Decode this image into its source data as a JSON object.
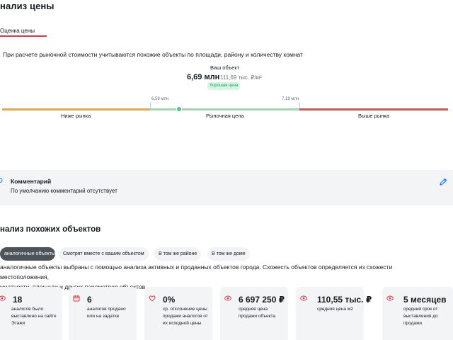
{
  "price_analysis": {
    "title": "нализ цены",
    "tab": "Оценка цены",
    "description": "При расчете рыночной стоимости учитываются похожие объекты по площади, району и количеству комнат",
    "your_object_label": "Ваш объект",
    "your_price": "6,69 млн",
    "your_price_per_m2": "111,69 тыс. ₽/м²",
    "badge": "Хорошая цена",
    "tick_left": "6,58 млн",
    "tick_right": "7,18 млн",
    "segments": {
      "low": "Ниже рынка",
      "mid": "Рыночная цена",
      "high": "Выше рынка"
    },
    "colors": {
      "low": "#f5a623",
      "mid": "#9ad9b0",
      "high": "#e94b4b",
      "accent": "#e3343f"
    }
  },
  "comment": {
    "title": "Комментарий",
    "text": "По умолчанию комментарий отсутствует"
  },
  "similar": {
    "title": "нализ похожих объектов",
    "chips": [
      "аналогичные объекты",
      "Смотрят вместе с вашим объектом",
      "В том же районе",
      "В том же доме"
    ],
    "info_line1": "аналогичные объекты выбраны с помощью анализа активных и проданных объектов города. Схожесть объектов определяется из схожести местоположения,",
    "info_line2": "мнатности, площади и других параметров объектов",
    "cards": [
      {
        "icon": "eye-icon",
        "value": "18",
        "label": "аналогов было выставлено на сайте Этажи"
      },
      {
        "icon": "calendar-icon",
        "value": "6",
        "label": "аналогов продано или на задатке"
      },
      {
        "icon": "heart-icon",
        "value": "0%",
        "label": "ср. отклонение цены продажи аналогов от их исходной цены"
      },
      {
        "icon": "eye-icon",
        "value": "6 697 250 ₽",
        "label": "средняя цена продажи объекта"
      },
      {
        "icon": "eye-icon",
        "value": "110,55 тыс. ₽",
        "label": "средняя цена м2"
      },
      {
        "icon": "eye-icon",
        "value": "5 месяцев",
        "label": "средний срок от выставления до продажи"
      }
    ]
  }
}
